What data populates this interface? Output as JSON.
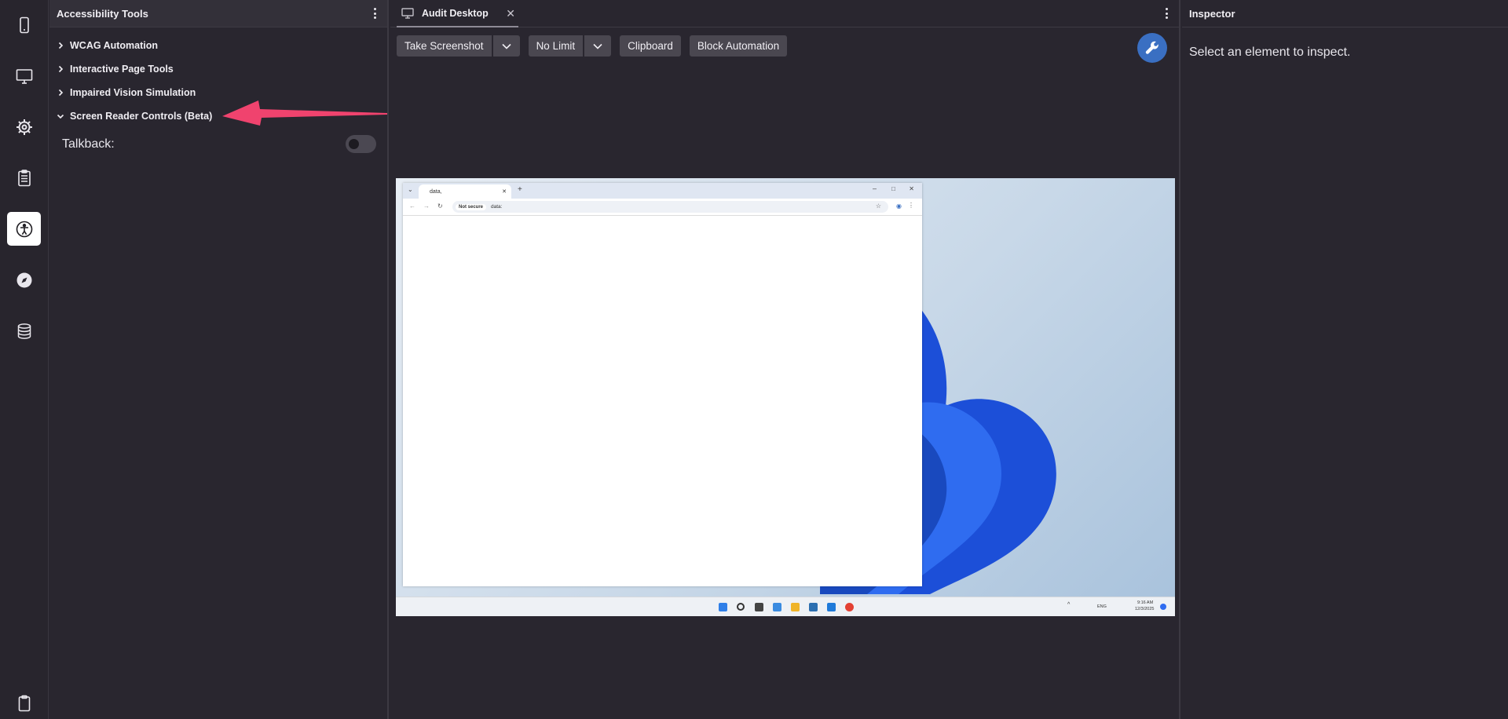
{
  "rail": {
    "items": [
      {
        "name": "mobile-icon"
      },
      {
        "name": "desktop-icon"
      },
      {
        "name": "settings-gear-icon"
      },
      {
        "name": "checklist-icon"
      },
      {
        "name": "accessibility-icon",
        "active": true
      },
      {
        "name": "compass-icon"
      },
      {
        "name": "database-icon"
      }
    ],
    "bottom": "clipboard-icon"
  },
  "a11y_panel": {
    "title": "Accessibility Tools",
    "sections": [
      {
        "label": "WCAG Automation",
        "expanded": false
      },
      {
        "label": "Interactive Page Tools",
        "expanded": false
      },
      {
        "label": "Impaired Vision Simulation",
        "expanded": false
      },
      {
        "label": "Screen Reader Controls (Beta)",
        "expanded": true
      }
    ],
    "talkback_label": "Talkback:",
    "talkback_on": false
  },
  "center": {
    "tab_title": "Audit Desktop",
    "toolbar": {
      "screenshot_label": "Take Screenshot",
      "limit_label": "No Limit",
      "clipboard_label": "Clipboard",
      "block_label": "Block Automation"
    },
    "mirror": {
      "browser_tab": "data,",
      "not_secure": "Not secure",
      "url": "data:",
      "tray_lang": "ENG",
      "tray_time": "9:16 AM",
      "tray_date": "12/3/2025"
    }
  },
  "inspector": {
    "title": "Inspector",
    "message": "Select an element to inspect."
  },
  "colors": {
    "background": "#29262f",
    "accent_blue": "#3a6fc2",
    "arrow": "#f0436e"
  }
}
